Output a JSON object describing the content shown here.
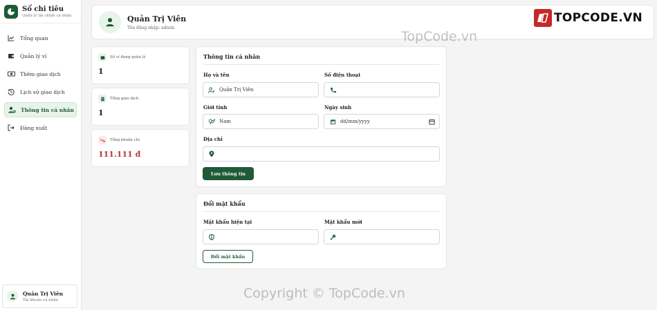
{
  "brand": {
    "title": "Sổ chi tiêu",
    "subtitle": "Quản lý tài chính cá nhân"
  },
  "nav": [
    {
      "label": "Tổng quan",
      "icon": "chart-line-icon",
      "active": false
    },
    {
      "label": "Quản lý ví",
      "icon": "wallet-icon",
      "active": false
    },
    {
      "label": "Thêm giao dịch",
      "icon": "money-icon",
      "active": false
    },
    {
      "label": "Lịch sử giao dịch",
      "icon": "history-icon",
      "active": false
    },
    {
      "label": "Thông tin cá nhân",
      "icon": "user-gear-icon",
      "active": true
    },
    {
      "label": "Đăng xuất",
      "icon": "logout-icon",
      "active": false
    }
  ],
  "user_card": {
    "name": "Quản Trị Viên",
    "role": "Tài khoản cá nhân"
  },
  "header": {
    "name": "Quản Trị Viên",
    "login": "Tên đăng nhập: admin"
  },
  "watermark": {
    "logo_text": "TOPCODE.VN",
    "site": "TopCode.vn",
    "copyright": "Copyright © TopCode.vn"
  },
  "stats": [
    {
      "label": "Số ví đang quản lý",
      "value": "1",
      "icon": "wallet-icon"
    },
    {
      "label": "Tổng giao dịch",
      "value": "1",
      "icon": "receipt-icon"
    },
    {
      "label": "Tổng khoản chi",
      "value": "111.111 đ",
      "icon": "trend-down-icon"
    }
  ],
  "profile": {
    "title": "Thông tin cá nhân",
    "fullname_label": "Họ và tên",
    "fullname_value": "Quản Trị Viên",
    "phone_label": "Số điện thoại",
    "phone_value": "",
    "gender_label": "Giới tính",
    "gender_value": "Nam",
    "dob_label": "Ngày sinh",
    "dob_placeholder": "dd/mm/yyyy",
    "address_label": "Địa chỉ",
    "address_value": "",
    "save_label": "Lưu thông tin"
  },
  "password": {
    "title": "Đổi mật khẩu",
    "current_label": "Mật khẩu hiện tại",
    "new_label": "Mật khẩu mới",
    "submit_label": "Đổi mật khẩu"
  },
  "colors": {
    "primary": "#1e5b36",
    "accent_red": "#b23a3a",
    "light_green": "#e8f3ea"
  }
}
